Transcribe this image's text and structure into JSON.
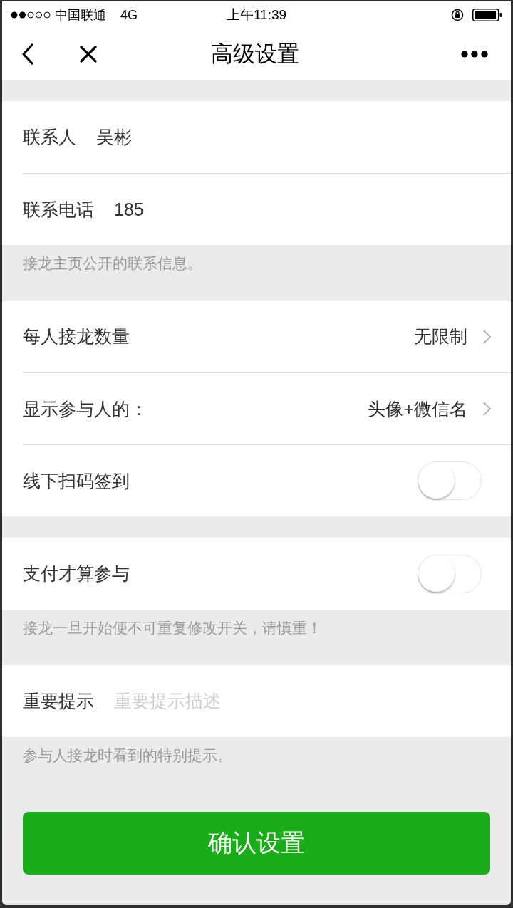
{
  "status_bar": {
    "carrier": "中国联通",
    "network": "4G",
    "time": "上午11:39"
  },
  "nav_bar": {
    "title": "高级设置"
  },
  "sections": [
    {
      "rows": [
        {
          "kind": "field",
          "label": "联系人",
          "value": "吴彬"
        },
        {
          "kind": "field",
          "label": "联系电话",
          "value": "185"
        }
      ],
      "note": "接龙主页公开的联系信息。"
    },
    {
      "rows": [
        {
          "kind": "select",
          "label": "每人接龙数量",
          "value": "无限制"
        },
        {
          "kind": "select",
          "label": "显示参与人的：",
          "value": "头像+微信名"
        },
        {
          "kind": "switch",
          "label": "线下扫码签到",
          "on": false
        }
      ]
    },
    {
      "rows": [
        {
          "kind": "switch",
          "label": "支付才算参与",
          "on": false
        }
      ],
      "note": "接龙一旦开始便不可重复修改开关，请慎重！"
    },
    {
      "rows": [
        {
          "kind": "field",
          "label": "重要提示",
          "placeholder": "重要提示描述"
        }
      ],
      "note": "参与人接龙时看到的特别提示。"
    }
  ],
  "confirm_button": {
    "label": "确认设置"
  }
}
